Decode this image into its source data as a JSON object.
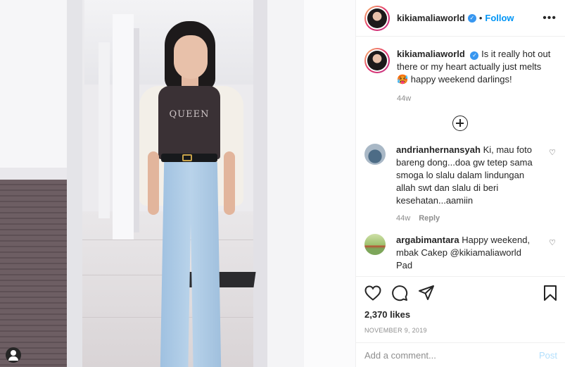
{
  "post": {
    "username": "kikiamaliaworld",
    "follow_label": "Follow",
    "caption_text": "Is it really hot out there or my heart actually just melts 🥵 happy weekend darlings!",
    "caption_time": "44w",
    "likes": "2,370 likes",
    "date": "NOVEMBER 9, 2019",
    "photo_shirt_text": "QUEEN"
  },
  "comments": [
    {
      "username": "andrianhernansyah",
      "text": "Ki, mau foto bareng dong...doa gw tetep sama smoga lo slalu dalam lindungan allah swt dan slalu di beri kesehatan...aamiin",
      "time": "44w",
      "reply_label": "Reply"
    },
    {
      "username": "argabimantara",
      "text": "Happy weekend, mbak Cakep @kikiamaliaworld Pad"
    }
  ],
  "comment_box": {
    "placeholder": "Add a comment...",
    "post_label": "Post"
  },
  "colors": {
    "accent": "#0095f6",
    "verified": "#3897f0",
    "post_disabled": "#b2dffc"
  }
}
